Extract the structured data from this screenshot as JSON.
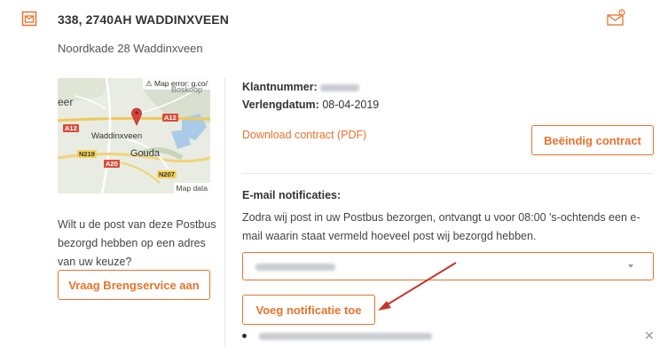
{
  "header": {
    "title": "338, 2740AH WADDINXVEEN",
    "address": "Noordkade 28 Waddinxveen",
    "mailbox_icon": "mailbox-icon",
    "envelope_icon": "envelope-notification-icon"
  },
  "map": {
    "error_text": "⚠ Map error: g.co/",
    "data_text": "Map data",
    "labels": {
      "eer": "eer",
      "waddinxveen": "Waddinxveen",
      "gouda": "Gouda",
      "boskoop": "Boskoop"
    },
    "roads": {
      "a12_left": "A12",
      "a12_right": "A12",
      "n219": "N219",
      "a20": "A20",
      "n207": "N207"
    }
  },
  "left": {
    "description": "Wilt u de post van deze Postbus bezorgd hebben op een adres van uw keuze?",
    "brengservice_button": "Vraag Brengservice aan"
  },
  "contract": {
    "klantnummer_label": "Klantnummer:",
    "verlengdatum_label": "Verlengdatum:",
    "verlengdatum_value": "08-04-2019",
    "download_link": "Download contract (PDF)",
    "beeindig_button": "Beëindig contract"
  },
  "notifications": {
    "title": "E-mail notificaties:",
    "description": "Zodra wij post in uw Postbus bezorgen, ontvangt u voor 08:00 's-ochtends een e-mail waarin staat vermeld hoeveel post wij bezorgd hebben.",
    "add_button": "Voeg notificatie toe"
  },
  "colors": {
    "accent": "#e8732c",
    "arrow": "#c0392b"
  }
}
